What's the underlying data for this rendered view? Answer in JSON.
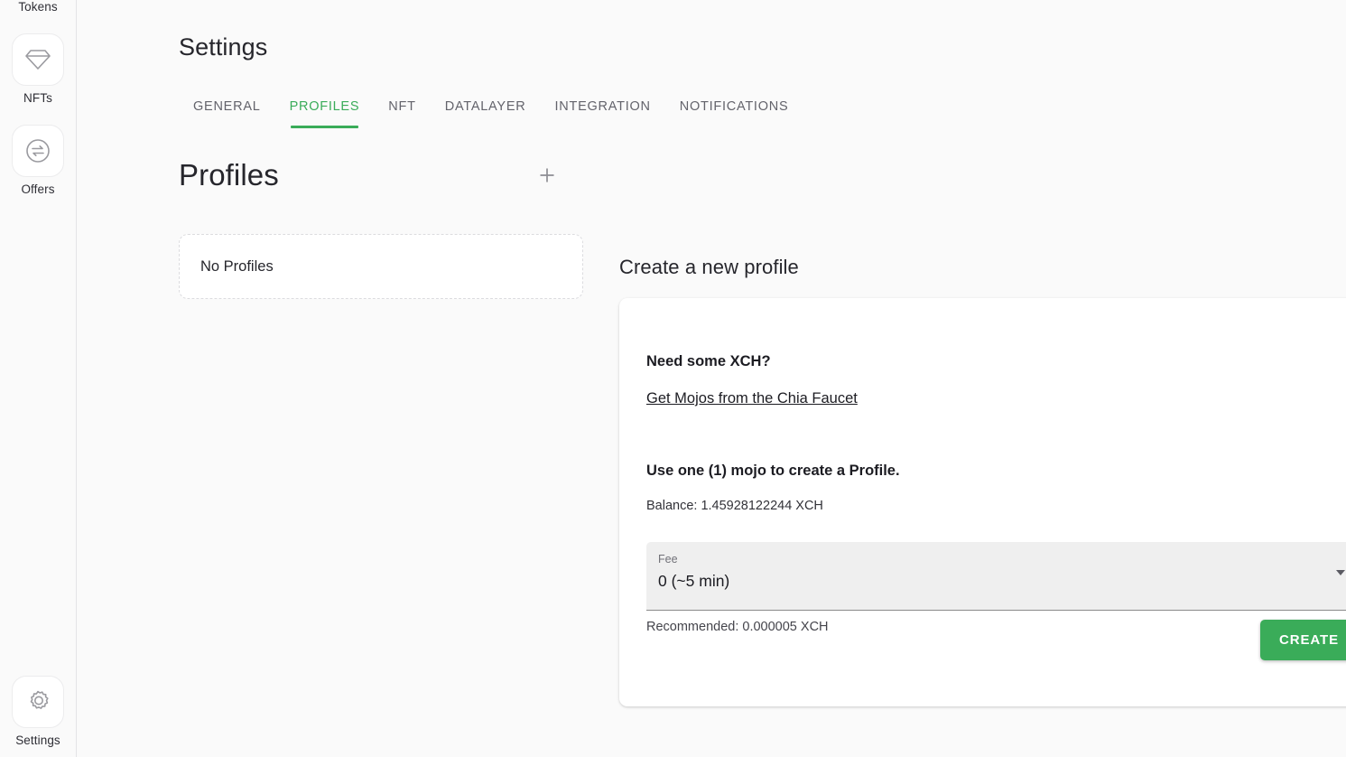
{
  "sidebar": {
    "items": [
      {
        "label": "Tokens",
        "icon": "tokens-icon"
      },
      {
        "label": "NFTs",
        "icon": "diamond-icon"
      },
      {
        "label": "Offers",
        "icon": "swap-arrows-icon"
      }
    ],
    "bottom_item": {
      "label": "Settings",
      "icon": "gear-icon"
    }
  },
  "header": {
    "title": "Settings"
  },
  "tabs": [
    {
      "label": "GENERAL",
      "active": false
    },
    {
      "label": "PROFILES",
      "active": true
    },
    {
      "label": "NFT",
      "active": false
    },
    {
      "label": "DATALAYER",
      "active": false
    },
    {
      "label": "INTEGRATION",
      "active": false
    },
    {
      "label": "NOTIFICATIONS",
      "active": false
    }
  ],
  "profiles": {
    "section_title": "Profiles",
    "add_icon": "plus-icon",
    "empty_text": "No Profiles"
  },
  "create_panel": {
    "heading": "Create a new profile",
    "need_xch_title": "Need some XCH?",
    "faucet_link": "Get Mojos from the Chia Faucet",
    "mojo_note": "Use one (1) mojo to create a Profile.",
    "balance": "Balance: 1.45928122244 XCH",
    "fee": {
      "label": "Fee",
      "value": "0 (~5 min)",
      "caret_icon": "chevron-down-icon",
      "options": [
        "0 (~5 min)"
      ],
      "recommended": "Recommended: 0.000005 XCH"
    },
    "create_button": "CREATE"
  },
  "colors": {
    "accent_green": "#3aac59",
    "page_background": "#fafafa",
    "card_background": "#ffffff",
    "field_background": "#efefef"
  }
}
